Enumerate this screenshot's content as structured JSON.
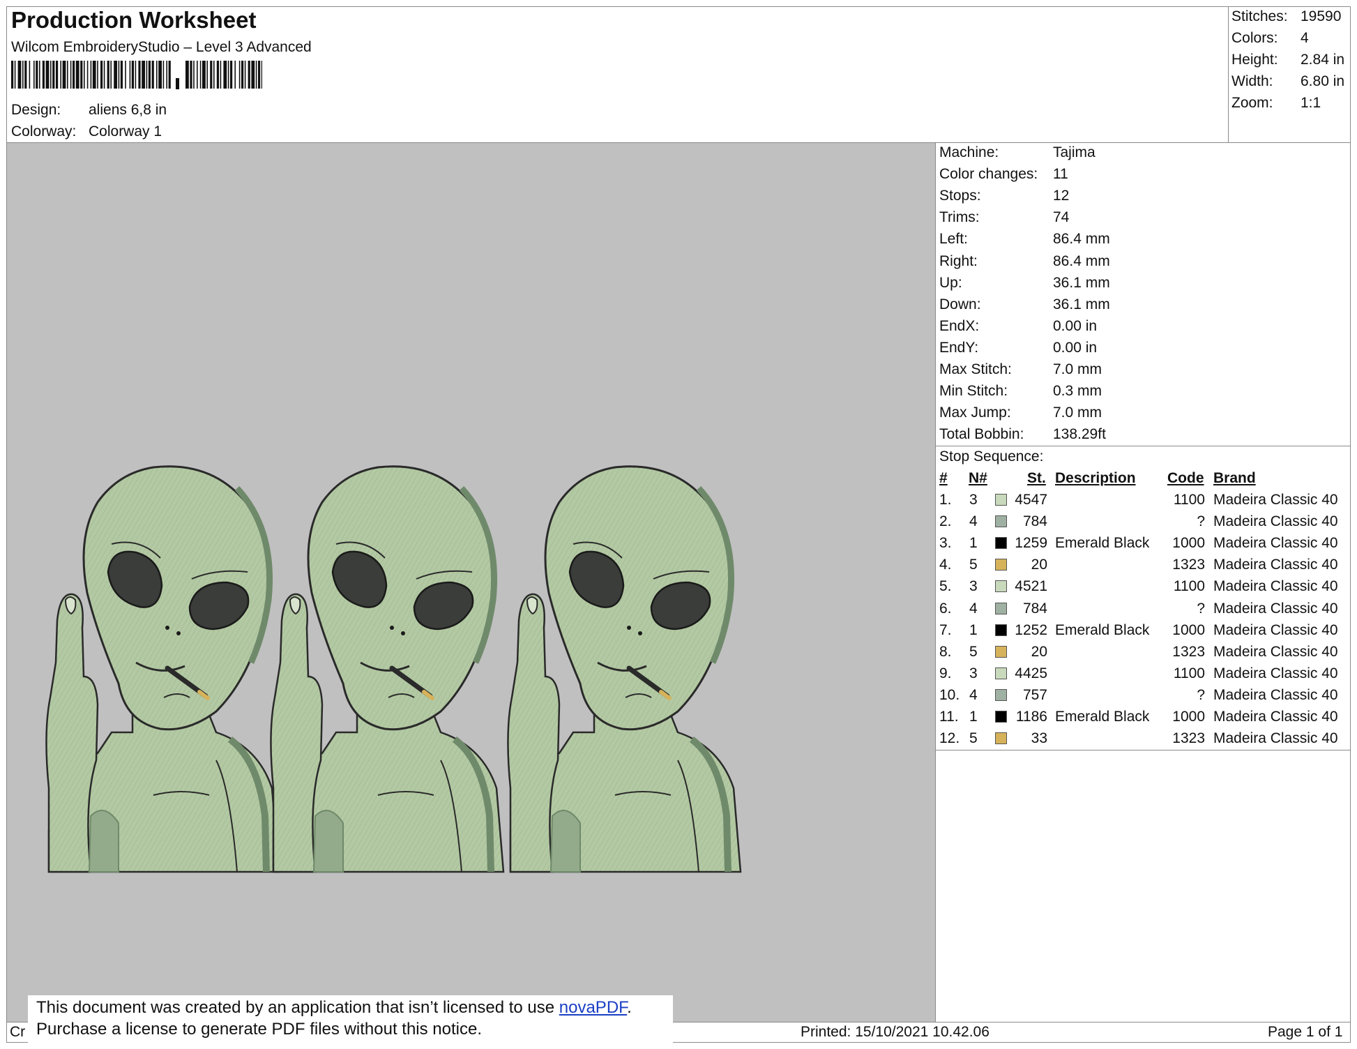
{
  "header": {
    "title": "Production Worksheet",
    "software": "Wilcom EmbroideryStudio – Level 3 Advanced",
    "design_label": "Design:",
    "design_value": "aliens 6,8 in",
    "colorway_label": "Colorway:",
    "colorway_value": "Colorway 1"
  },
  "summary": [
    {
      "label": "Stitches:",
      "value": "19590"
    },
    {
      "label": "Colors:",
      "value": "4"
    },
    {
      "label": "Height:",
      "value": "2.84 in"
    },
    {
      "label": "Width:",
      "value": "6.80 in"
    },
    {
      "label": "Zoom:",
      "value": "1:1"
    }
  ],
  "specs": [
    {
      "label": "Machine:",
      "value": "Tajima"
    },
    {
      "label": "Color changes:",
      "value": "11"
    },
    {
      "label": "Stops:",
      "value": "12"
    },
    {
      "label": "Trims:",
      "value": "74"
    },
    {
      "label": "Left:",
      "value": "86.4 mm"
    },
    {
      "label": "Right:",
      "value": "86.4 mm"
    },
    {
      "label": "Up:",
      "value": "36.1 mm"
    },
    {
      "label": "Down:",
      "value": "36.1 mm"
    },
    {
      "label": "EndX:",
      "value": "0.00 in"
    },
    {
      "label": "EndY:",
      "value": "0.00 in"
    },
    {
      "label": "Max Stitch:",
      "value": "7.0 mm"
    },
    {
      "label": "Min Stitch:",
      "value": "0.3 mm"
    },
    {
      "label": "Max Jump:",
      "value": "7.0 mm"
    },
    {
      "label": "Total Bobbin:",
      "value": "138.29ft"
    }
  ],
  "stop_sequence": {
    "title": "Stop Sequence:",
    "headers": {
      "num": "#",
      "needle": "N#",
      "stitches": "St.",
      "description": "Description",
      "code": "Code",
      "brand": "Brand"
    },
    "rows": [
      {
        "num": "1.",
        "needle": "3",
        "color": "#c8d9bc",
        "stitches": "4547",
        "description": "",
        "code": "1100",
        "brand": "Madeira Classic 40"
      },
      {
        "num": "2.",
        "needle": "4",
        "color": "#9fb1a2",
        "stitches": "784",
        "description": "",
        "code": "?",
        "brand": "Madeira Classic 40"
      },
      {
        "num": "3.",
        "needle": "1",
        "color": "#000000",
        "stitches": "1259",
        "description": "Emerald Black",
        "code": "1000",
        "brand": "Madeira Classic 40"
      },
      {
        "num": "4.",
        "needle": "5",
        "color": "#d6b25a",
        "stitches": "20",
        "description": "",
        "code": "1323",
        "brand": "Madeira Classic 40"
      },
      {
        "num": "5.",
        "needle": "3",
        "color": "#c8d9bc",
        "stitches": "4521",
        "description": "",
        "code": "1100",
        "brand": "Madeira Classic 40"
      },
      {
        "num": "6.",
        "needle": "4",
        "color": "#9fb1a2",
        "stitches": "784",
        "description": "",
        "code": "?",
        "brand": "Madeira Classic 40"
      },
      {
        "num": "7.",
        "needle": "1",
        "color": "#000000",
        "stitches": "1252",
        "description": "Emerald Black",
        "code": "1000",
        "brand": "Madeira Classic 40"
      },
      {
        "num": "8.",
        "needle": "5",
        "color": "#d6b25a",
        "stitches": "20",
        "description": "",
        "code": "1323",
        "brand": "Madeira Classic 40"
      },
      {
        "num": "9.",
        "needle": "3",
        "color": "#c8d9bc",
        "stitches": "4425",
        "description": "",
        "code": "1100",
        "brand": "Madeira Classic 40"
      },
      {
        "num": "10.",
        "needle": "4",
        "color": "#9fb1a2",
        "stitches": "757",
        "description": "",
        "code": "?",
        "brand": "Madeira Classic 40"
      },
      {
        "num": "11.",
        "needle": "1",
        "color": "#000000",
        "stitches": "1186",
        "description": "Emerald Black",
        "code": "1000",
        "brand": "Madeira Classic 40"
      },
      {
        "num": "12.",
        "needle": "5",
        "color": "#d6b25a",
        "stitches": "33",
        "description": "",
        "code": "1323",
        "brand": "Madeira Classic 40"
      }
    ]
  },
  "colors": {
    "alien_fill": "#b3c9a3",
    "alien_shade": "#94ab8b",
    "eye": "#3a3d39",
    "cigarette_tip": "#d6b25a",
    "canvas": "#c0c0c0"
  },
  "footer": {
    "left_fragment": "Cr",
    "printed": "Printed: 15/10/2021 10.42.06",
    "page": "Page 1 of 1"
  },
  "notice": {
    "line1_before": "This document was created by an application that isn’t licensed to use ",
    "link": "novaPDF",
    "line1_after": ".",
    "line2": "Purchase a license to generate PDF files without this notice."
  }
}
